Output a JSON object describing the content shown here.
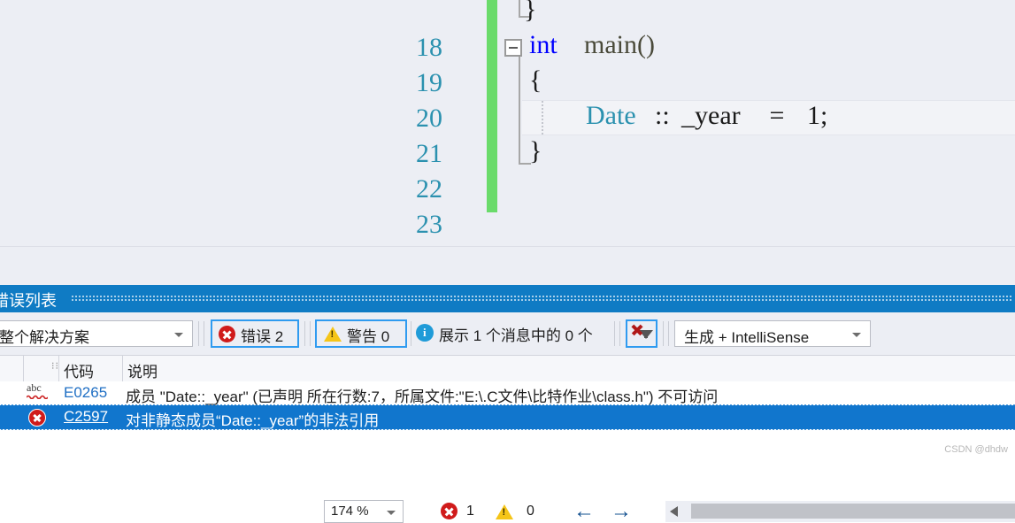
{
  "editor": {
    "zoom_level": "174 %",
    "lines": [
      {
        "number": "18",
        "text": "}"
      },
      {
        "number": "19",
        "text": "int main()"
      },
      {
        "number": "20",
        "text": "{"
      },
      {
        "number": "21",
        "text": "Date::_year = 1;"
      },
      {
        "number": "22",
        "text": "}"
      },
      {
        "number": "23",
        "text": ""
      }
    ],
    "tokens": {
      "kw_int": "int",
      "fn_main": "main()",
      "type_date": "Date",
      "scope_op": "::",
      "member": "_year",
      "assign": " = ",
      "literal": "1;",
      "brace_open": "{",
      "brace_close": "}"
    }
  },
  "status_bar": {
    "error_icon": "error-circle-icon",
    "error_count": "1",
    "warning_icon": "warning-triangle-icon",
    "warning_count": "0",
    "back_arrow": "←",
    "forward_arrow": "→"
  },
  "panel": {
    "title": "错误列表",
    "scope_filter": "整个解决方案",
    "errors_button": "错误 2",
    "warnings_button": "警告 0",
    "messages_label": "展示 1 个消息中的 0 个",
    "clear_filter_icon": "clear-filter-icon",
    "build_filter": "生成 + IntelliSense",
    "columns": [
      "代码",
      "说明"
    ],
    "rows": [
      {
        "icon": "spellcheck-abc-icon",
        "code": "E0265",
        "description": "成员 \"Date::_year\" (已声明 所在行数:7，所属文件:\"E:\\.C文件\\比特作业\\class.h\") 不可访问",
        "selected": false
      },
      {
        "icon": "error-circle-icon",
        "code": "C2597",
        "description": "对非静态成员“Date::_year”的非法引用",
        "selected": true
      }
    ]
  },
  "watermark": "CSDN @dhdw",
  "colors": {
    "accent_blue": "#0f7bc4",
    "selection_blue": "#1176cd",
    "error_red": "#d01b1b",
    "warning_yellow": "#f5c518",
    "change_bar_green": "#6adb6a",
    "editor_bg": "#eceef4",
    "line_number": "#2b91af"
  }
}
